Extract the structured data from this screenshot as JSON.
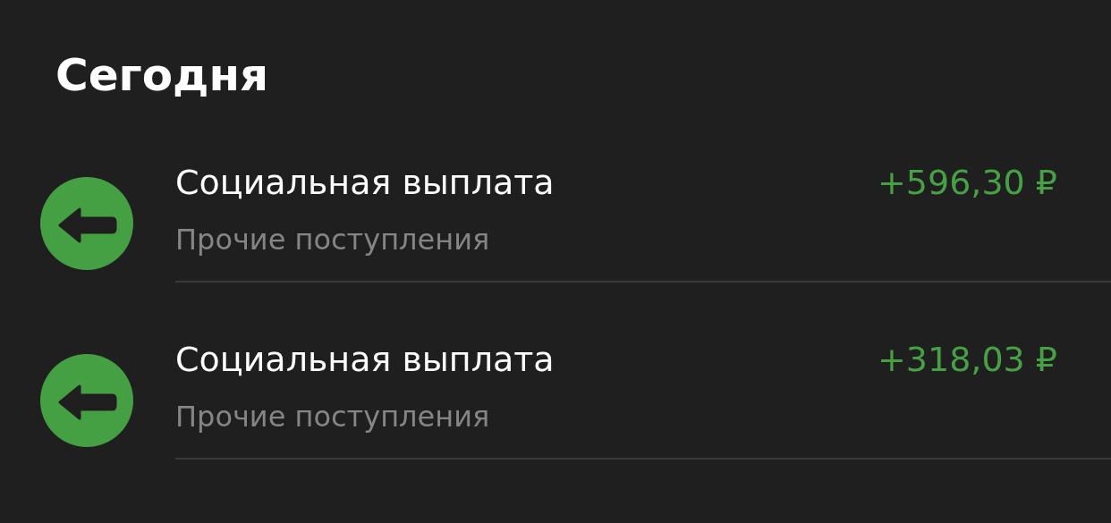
{
  "section_title": "Сегодня",
  "transactions": [
    {
      "kind": "income",
      "title": "Социальная выплата",
      "category": "Прочие поступления",
      "amount": "+596,30 ₽"
    },
    {
      "kind": "income",
      "title": "Социальная выплата",
      "category": "Прочие поступления",
      "amount": "+318,03 ₽"
    }
  ]
}
